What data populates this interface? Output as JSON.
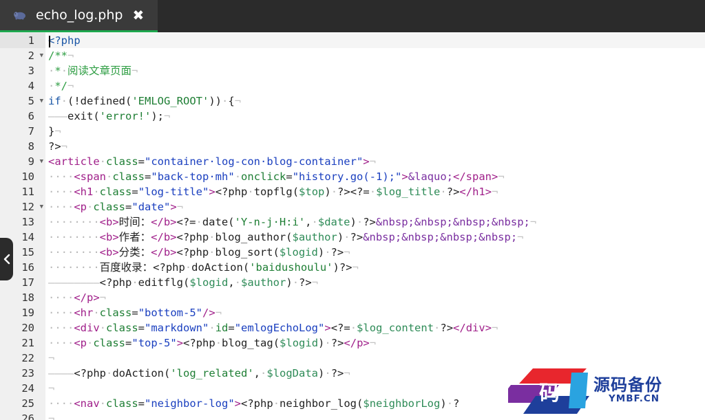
{
  "tab": {
    "title": "echo_log.php",
    "close_glyph": "✖",
    "icon": "php-elephant-icon",
    "accent": "#1fa84f"
  },
  "editor": {
    "active_line": 1,
    "lines": [
      {
        "n": "1",
        "fold": false,
        "tokens": [
          [
            "t-kw",
            "<?php"
          ]
        ]
      },
      {
        "n": "2",
        "fold": true,
        "tokens": [
          [
            "t-cmt",
            "/**"
          ],
          [
            "t-eol",
            "¬"
          ]
        ]
      },
      {
        "n": "3",
        "fold": false,
        "tokens": [
          [
            "t-ws",
            "·"
          ],
          [
            "t-cmt",
            "*"
          ],
          [
            "t-ws",
            "·"
          ],
          [
            "t-cmt",
            "阅读文章页面"
          ],
          [
            "t-eol",
            "¬"
          ]
        ]
      },
      {
        "n": "4",
        "fold": false,
        "tokens": [
          [
            "t-ws",
            "·"
          ],
          [
            "t-cmt",
            "*/"
          ],
          [
            "t-eol",
            "¬"
          ]
        ]
      },
      {
        "n": "5",
        "fold": true,
        "tokens": [
          [
            "t-kw",
            "if"
          ],
          [
            "t-ws",
            "·"
          ],
          [
            "t-plain",
            "(!defined("
          ],
          [
            "t-sstr",
            "'EMLOG_ROOT'"
          ],
          [
            "t-plain",
            "))"
          ],
          [
            "t-ws",
            "·"
          ],
          [
            "t-plain",
            "{"
          ],
          [
            "t-eol",
            "¬"
          ]
        ]
      },
      {
        "n": "6",
        "fold": false,
        "tokens": [
          [
            "t-ws",
            "———"
          ],
          [
            "t-plain",
            "exit("
          ],
          [
            "t-sstr",
            "'error!'"
          ],
          [
            "t-plain",
            ");"
          ],
          [
            "t-eol",
            "¬"
          ]
        ]
      },
      {
        "n": "7",
        "fold": false,
        "tokens": [
          [
            "t-plain",
            "}"
          ],
          [
            "t-eol",
            "¬"
          ]
        ]
      },
      {
        "n": "8",
        "fold": false,
        "tokens": [
          [
            "t-plain",
            "?>"
          ],
          [
            "t-eol",
            "¬"
          ]
        ]
      },
      {
        "n": "9",
        "fold": true,
        "tokens": [
          [
            "t-tag",
            "<article"
          ],
          [
            "t-ws",
            "·"
          ],
          [
            "t-attr",
            "class"
          ],
          [
            "t-plain",
            "="
          ],
          [
            "t-str",
            "\"container·log-con·blog-container\""
          ],
          [
            "t-tag",
            ">"
          ],
          [
            "t-eol",
            "¬"
          ]
        ]
      },
      {
        "n": "10",
        "fold": false,
        "tokens": [
          [
            "t-ws",
            "····"
          ],
          [
            "t-tag",
            "<span"
          ],
          [
            "t-ws",
            "·"
          ],
          [
            "t-attr",
            "class"
          ],
          [
            "t-plain",
            "="
          ],
          [
            "t-str",
            "\"back-top·mh\""
          ],
          [
            "t-ws",
            "·"
          ],
          [
            "t-attr",
            "onclick"
          ],
          [
            "t-plain",
            "="
          ],
          [
            "t-str",
            "\"history.go(-1);\""
          ],
          [
            "t-tag",
            ">"
          ],
          [
            "t-ent",
            "&laquo;"
          ],
          [
            "t-tag",
            "</span>"
          ],
          [
            "t-eol",
            "¬"
          ]
        ]
      },
      {
        "n": "11",
        "fold": false,
        "tokens": [
          [
            "t-ws",
            "····"
          ],
          [
            "t-tag",
            "<h1"
          ],
          [
            "t-ws",
            "·"
          ],
          [
            "t-attr",
            "class"
          ],
          [
            "t-plain",
            "="
          ],
          [
            "t-str",
            "\"log-title\""
          ],
          [
            "t-tag",
            ">"
          ],
          [
            "t-plain",
            "<?php"
          ],
          [
            "t-ws",
            "·"
          ],
          [
            "t-plain",
            "topflg("
          ],
          [
            "t-var",
            "$top"
          ],
          [
            "t-plain",
            ")"
          ],
          [
            "t-ws",
            "·"
          ],
          [
            "t-plain",
            "?><?="
          ],
          [
            "t-ws",
            "·"
          ],
          [
            "t-var",
            "$log_title"
          ],
          [
            "t-ws",
            "·"
          ],
          [
            "t-plain",
            "?>"
          ],
          [
            "t-tag",
            "</h1>"
          ],
          [
            "t-eol",
            "¬"
          ]
        ]
      },
      {
        "n": "12",
        "fold": true,
        "tokens": [
          [
            "t-ws",
            "····"
          ],
          [
            "t-tag",
            "<p"
          ],
          [
            "t-ws",
            "·"
          ],
          [
            "t-attr",
            "class"
          ],
          [
            "t-plain",
            "="
          ],
          [
            "t-str",
            "\"date\""
          ],
          [
            "t-tag",
            ">"
          ],
          [
            "t-eol",
            "¬"
          ]
        ]
      },
      {
        "n": "13",
        "fold": false,
        "tokens": [
          [
            "t-ws",
            "········"
          ],
          [
            "t-tag",
            "<b>"
          ],
          [
            "t-plain",
            "时间："
          ],
          [
            "t-tag",
            "</b>"
          ],
          [
            "t-plain",
            "<?="
          ],
          [
            "t-ws",
            "·"
          ],
          [
            "t-plain",
            "date("
          ],
          [
            "t-sstr",
            "'Y-n-j·H:i'"
          ],
          [
            "t-plain",
            ","
          ],
          [
            "t-ws",
            "·"
          ],
          [
            "t-var",
            "$date"
          ],
          [
            "t-plain",
            ")"
          ],
          [
            "t-ws",
            "·"
          ],
          [
            "t-plain",
            "?>"
          ],
          [
            "t-ent",
            "&nbsp;&nbsp;&nbsp;&nbsp;"
          ],
          [
            "t-eol",
            "¬"
          ]
        ]
      },
      {
        "n": "14",
        "fold": false,
        "tokens": [
          [
            "t-ws",
            "········"
          ],
          [
            "t-tag",
            "<b>"
          ],
          [
            "t-plain",
            "作者："
          ],
          [
            "t-tag",
            "</b>"
          ],
          [
            "t-plain",
            "<?php"
          ],
          [
            "t-ws",
            "·"
          ],
          [
            "t-plain",
            "blog_author("
          ],
          [
            "t-var",
            "$author"
          ],
          [
            "t-plain",
            ")"
          ],
          [
            "t-ws",
            "·"
          ],
          [
            "t-plain",
            "?>"
          ],
          [
            "t-ent",
            "&nbsp;&nbsp;&nbsp;&nbsp;"
          ],
          [
            "t-eol",
            "¬"
          ]
        ]
      },
      {
        "n": "15",
        "fold": false,
        "tokens": [
          [
            "t-ws",
            "········"
          ],
          [
            "t-tag",
            "<b>"
          ],
          [
            "t-plain",
            "分类："
          ],
          [
            "t-tag",
            "</b>"
          ],
          [
            "t-plain",
            "<?php"
          ],
          [
            "t-ws",
            "·"
          ],
          [
            "t-plain",
            "blog_sort("
          ],
          [
            "t-var",
            "$logid"
          ],
          [
            "t-plain",
            ")"
          ],
          [
            "t-ws",
            "·"
          ],
          [
            "t-plain",
            "?>"
          ],
          [
            "t-eol",
            "¬"
          ]
        ]
      },
      {
        "n": "16",
        "fold": false,
        "tokens": [
          [
            "t-ws",
            "········"
          ],
          [
            "t-plain",
            "百度收录：<?php"
          ],
          [
            "t-ws",
            "·"
          ],
          [
            "t-plain",
            "doAction("
          ],
          [
            "t-sstr",
            "'baidushoulu'"
          ],
          [
            "t-plain",
            ")?>"
          ],
          [
            "t-eol",
            "¬"
          ]
        ]
      },
      {
        "n": "17",
        "fold": false,
        "tokens": [
          [
            "t-ws",
            "————————"
          ],
          [
            "t-plain",
            "<?php"
          ],
          [
            "t-ws",
            "·"
          ],
          [
            "t-plain",
            "editflg("
          ],
          [
            "t-var",
            "$logid"
          ],
          [
            "t-plain",
            ","
          ],
          [
            "t-ws",
            "·"
          ],
          [
            "t-var",
            "$author"
          ],
          [
            "t-plain",
            ")"
          ],
          [
            "t-ws",
            "·"
          ],
          [
            "t-plain",
            "?>"
          ],
          [
            "t-eol",
            "¬"
          ]
        ]
      },
      {
        "n": "18",
        "fold": false,
        "tokens": [
          [
            "t-ws",
            "····"
          ],
          [
            "t-tag",
            "</p>"
          ],
          [
            "t-eol",
            "¬"
          ]
        ]
      },
      {
        "n": "19",
        "fold": false,
        "tokens": [
          [
            "t-ws",
            "····"
          ],
          [
            "t-tag",
            "<hr"
          ],
          [
            "t-ws",
            "·"
          ],
          [
            "t-attr",
            "class"
          ],
          [
            "t-plain",
            "="
          ],
          [
            "t-str",
            "\"bottom-5\""
          ],
          [
            "t-tag",
            "/>"
          ],
          [
            "t-eol",
            "¬"
          ]
        ]
      },
      {
        "n": "20",
        "fold": false,
        "tokens": [
          [
            "t-ws",
            "····"
          ],
          [
            "t-tag",
            "<div"
          ],
          [
            "t-ws",
            "·"
          ],
          [
            "t-attr",
            "class"
          ],
          [
            "t-plain",
            "="
          ],
          [
            "t-str",
            "\"markdown\""
          ],
          [
            "t-ws",
            "·"
          ],
          [
            "t-attr",
            "id"
          ],
          [
            "t-plain",
            "="
          ],
          [
            "t-str",
            "\"emlogEchoLog\""
          ],
          [
            "t-tag",
            ">"
          ],
          [
            "t-plain",
            "<?="
          ],
          [
            "t-ws",
            "·"
          ],
          [
            "t-var",
            "$log_content"
          ],
          [
            "t-ws",
            "·"
          ],
          [
            "t-plain",
            "?>"
          ],
          [
            "t-tag",
            "</div>"
          ],
          [
            "t-eol",
            "¬"
          ]
        ]
      },
      {
        "n": "21",
        "fold": false,
        "tokens": [
          [
            "t-ws",
            "····"
          ],
          [
            "t-tag",
            "<p"
          ],
          [
            "t-ws",
            "·"
          ],
          [
            "t-attr",
            "class"
          ],
          [
            "t-plain",
            "="
          ],
          [
            "t-str",
            "\"top-5\""
          ],
          [
            "t-tag",
            ">"
          ],
          [
            "t-plain",
            "<?php"
          ],
          [
            "t-ws",
            "·"
          ],
          [
            "t-plain",
            "blog_tag("
          ],
          [
            "t-var",
            "$logid"
          ],
          [
            "t-plain",
            ")"
          ],
          [
            "t-ws",
            "·"
          ],
          [
            "t-plain",
            "?>"
          ],
          [
            "t-tag",
            "</p>"
          ],
          [
            "t-eol",
            "¬"
          ]
        ]
      },
      {
        "n": "22",
        "fold": false,
        "tokens": [
          [
            "t-eol",
            "¬"
          ]
        ]
      },
      {
        "n": "23",
        "fold": false,
        "tokens": [
          [
            "t-ws",
            "————"
          ],
          [
            "t-plain",
            "<?php"
          ],
          [
            "t-ws",
            "·"
          ],
          [
            "t-plain",
            "doAction("
          ],
          [
            "t-sstr",
            "'log_related'"
          ],
          [
            "t-plain",
            ","
          ],
          [
            "t-ws",
            "·"
          ],
          [
            "t-var",
            "$logData"
          ],
          [
            "t-plain",
            ")"
          ],
          [
            "t-ws",
            "·"
          ],
          [
            "t-plain",
            "?>"
          ],
          [
            "t-eol",
            "¬"
          ]
        ]
      },
      {
        "n": "24",
        "fold": false,
        "tokens": [
          [
            "t-eol",
            "¬"
          ]
        ]
      },
      {
        "n": "25",
        "fold": false,
        "tokens": [
          [
            "t-ws",
            "····"
          ],
          [
            "t-tag",
            "<nav"
          ],
          [
            "t-ws",
            "·"
          ],
          [
            "t-attr",
            "class"
          ],
          [
            "t-plain",
            "="
          ],
          [
            "t-str",
            "\"neighbor-log\""
          ],
          [
            "t-tag",
            ">"
          ],
          [
            "t-plain",
            "<?php"
          ],
          [
            "t-ws",
            "·"
          ],
          [
            "t-plain",
            "neighbor_log("
          ],
          [
            "t-var",
            "$neighborLog"
          ],
          [
            "t-plain",
            ")"
          ],
          [
            "t-ws",
            "·"
          ],
          [
            "t-plain",
            "?"
          ]
        ]
      },
      {
        "n": "26",
        "fold": false,
        "tokens": [
          [
            "t-eol",
            "¬"
          ]
        ]
      }
    ]
  },
  "collapse_handle": {
    "glyph": "‹",
    "icon": "chevron-left-icon"
  },
  "watermark": {
    "site_name": "源码备份",
    "domain": "YMBF.CN",
    "logo_char": "码",
    "colors": {
      "red": "#e8262d",
      "purple": "#7a2ea0",
      "blue": "#1e3f9b",
      "cyan": "#2aa3e0"
    }
  }
}
